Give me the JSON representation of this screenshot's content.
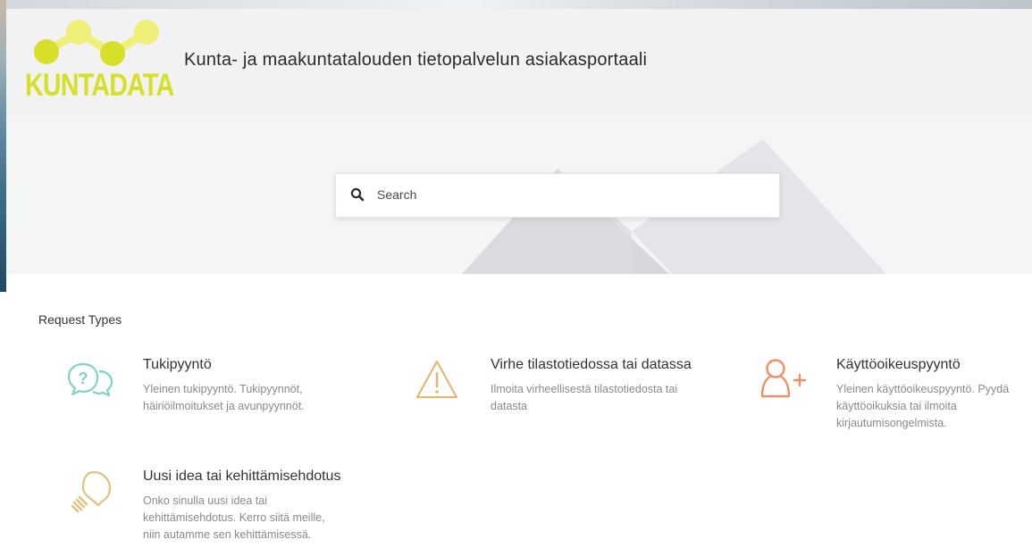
{
  "header": {
    "logo_text": "KUNTADATA",
    "title": "Kunta- ja maakuntatalouden tietopalvelun asiakasportaali"
  },
  "search": {
    "placeholder": "Search",
    "icon": "search-icon"
  },
  "request_types": {
    "heading": "Request Types",
    "items": [
      {
        "title": "Tukipyyntö",
        "desc_lines": [
          "Yleinen tukipyyntö. Tukipyynnöt,",
          "häiriöilmoitukset ja avunpyynnöt."
        ],
        "icon": "speech-bubbles-question-icon",
        "color": "#7fd3c1"
      },
      {
        "title": "Virhe tilastotiedossa tai datassa",
        "desc_lines": [
          "Ilmoita virheellisestä tilastotiedosta tai",
          "datasta"
        ],
        "icon": "warning-triangle-icon",
        "color": "#e0b97a"
      },
      {
        "title": "Käyttöoikeuspyyntö",
        "desc_lines": [
          "Yleinen käyttöoikeuspyyntö. Pyydä",
          "käyttöoikuksia tai ilmoita",
          "kirjautumisongelmista."
        ],
        "icon": "add-user-icon",
        "color": "#ef8f63"
      },
      {
        "title": "Uusi idea tai kehittämisehdotus",
        "desc_lines": [
          "Onko sinulla uusi idea tai",
          "kehittämisehdotus. Kerro siitä meille,",
          "niin autamme sen kehittämisessä."
        ],
        "icon": "lightbulb-icon",
        "color": "#e3c07e"
      }
    ]
  },
  "colors": {
    "logo_yellow": "#d6e02a",
    "header_bg": "#f2f2f2",
    "hero_bg": "#f4f5f7"
  }
}
